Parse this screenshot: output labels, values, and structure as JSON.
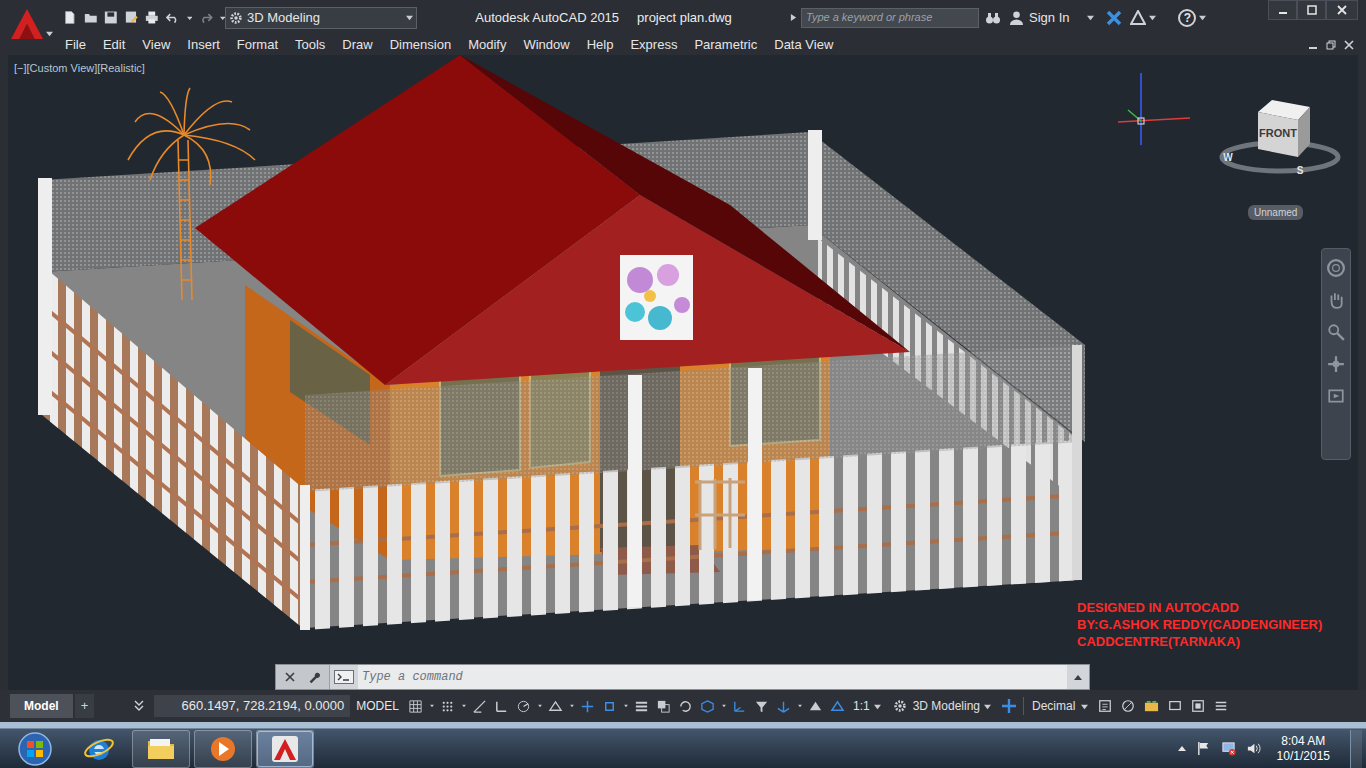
{
  "window": {
    "title_app": "Autodesk AutoCAD 2015",
    "title_file": "project plan.dwg"
  },
  "workspace": {
    "label": "3D Modeling"
  },
  "search": {
    "placeholder": "Type a keyword or phrase"
  },
  "account": {
    "label": "Sign In"
  },
  "help": {
    "label": "?"
  },
  "menu": [
    "File",
    "Edit",
    "View",
    "Insert",
    "Format",
    "Tools",
    "Draw",
    "Dimension",
    "Modify",
    "Window",
    "Help",
    "Express",
    "Parametric",
    "Data View"
  ],
  "viewport": {
    "label": "[−][Custom View][Realistic]",
    "viewcube": {
      "face": "FRONT",
      "compass": [
        "W",
        "S"
      ]
    },
    "named_view": "Unnamed",
    "credits": [
      "DESIGNED IN AUTOCADD",
      "BY:G.ASHOK REDDY(CADDENGINEER)",
      "CADDCENTRE(TARNAKA)"
    ]
  },
  "command_line": {
    "placeholder": "Type a command"
  },
  "layout_tabs": [
    {
      "label": "Model",
      "selected": true
    },
    {
      "label": "+",
      "selected": false
    }
  ],
  "status_bar": {
    "coordinates": "660.1497, 728.2194, 0.0000",
    "space": "MODEL",
    "scale": "1:1",
    "workspace": "3D Modeling",
    "units": "Decimal"
  },
  "taskbar": {
    "apps": [
      {
        "running": false,
        "selected": false
      },
      {
        "running": true,
        "selected": false
      },
      {
        "running": true,
        "selected": false
      },
      {
        "running": true,
        "selected": true
      }
    ],
    "time": "8:04 AM",
    "date": "10/1/2015"
  }
}
